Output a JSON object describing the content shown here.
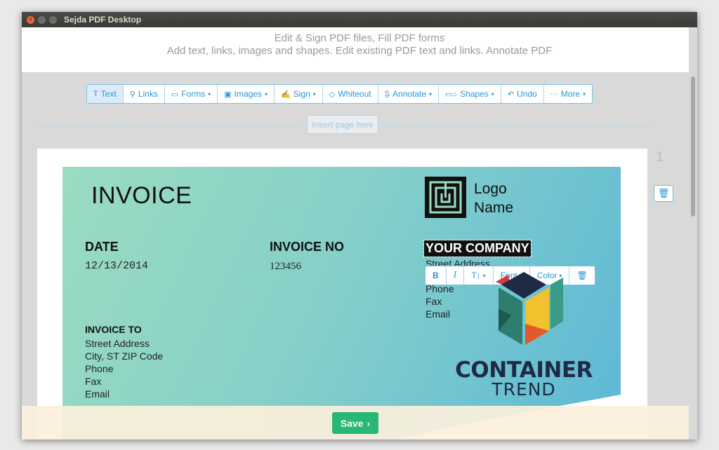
{
  "window": {
    "title": "Sejda PDF Desktop",
    "close_glyph": "×",
    "min_glyph": "–",
    "max_glyph": "□"
  },
  "header": {
    "line1": "Edit & Sign PDF files, Fill PDF forms",
    "line2": "Add text, links, images and shapes. Edit existing PDF text and links. Annotate PDF"
  },
  "toolbar": {
    "items": [
      {
        "label": "Text",
        "icon": "text-icon",
        "glyph": "T",
        "dropdown": false,
        "active": true
      },
      {
        "label": "Links",
        "icon": "link-icon",
        "glyph": "⚲",
        "dropdown": false
      },
      {
        "label": "Forms",
        "icon": "forms-icon",
        "glyph": "▭",
        "dropdown": true
      },
      {
        "label": "Images",
        "icon": "image-icon",
        "glyph": "▣",
        "dropdown": true
      },
      {
        "label": "Sign",
        "icon": "signature-icon",
        "glyph": "✍",
        "dropdown": true
      },
      {
        "label": "Whiteout",
        "icon": "eraser-icon",
        "glyph": "◇",
        "dropdown": false
      },
      {
        "label": "Annotate",
        "icon": "annotate-icon",
        "glyph": "S̲",
        "dropdown": true
      },
      {
        "label": "Shapes",
        "icon": "shapes-icon",
        "glyph": "▭○",
        "dropdown": true
      },
      {
        "label": "Undo",
        "icon": "undo-icon",
        "glyph": "↶",
        "dropdown": false
      },
      {
        "label": "More",
        "icon": "ellipsis-icon",
        "glyph": "···",
        "dropdown": true
      }
    ],
    "caret": "▾"
  },
  "insert_page_label": "Insert page here",
  "page_number": "1",
  "trash_glyph": "🗑",
  "invoice": {
    "title": "INVOICE",
    "logo_name_line1": "Logo",
    "logo_name_line2": "Name",
    "date_label": "DATE",
    "date_value": "12/13/2014",
    "invoice_no_label": "INVOICE NO",
    "invoice_no_value": "123456",
    "company_name": "YOUR COMPANY",
    "company_lines": [
      "Street Address",
      "Phone",
      "Fax",
      "Email"
    ],
    "invoice_to_label": "INVOICE TO",
    "invoice_to_lines": [
      "Street Address",
      "City, ST ZIP Code",
      "Phone",
      "Fax",
      "Email"
    ]
  },
  "text_edit_toolbar": {
    "bold": "B",
    "italic": "I",
    "size": "T↕",
    "font": "Font",
    "color": "Color",
    "caret": "▾",
    "trash": "🗑"
  },
  "save_button": {
    "label": "Save",
    "chevron": "›"
  },
  "watermark": {
    "line1": "CONTAINER",
    "line2": "TREND"
  },
  "colors": {
    "accent": "#2b96d2",
    "save": "#20b76e",
    "save_bar": "#fbf0dc"
  }
}
